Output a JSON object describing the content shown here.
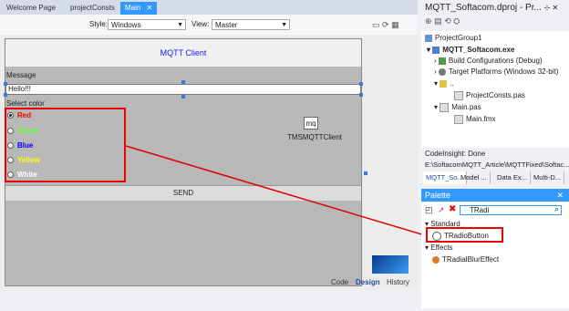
{
  "tabs": [
    {
      "label": "Welcome Page"
    },
    {
      "label": "projectConsts"
    },
    {
      "label": "Main"
    }
  ],
  "toolbar": {
    "style_label": "Style:",
    "style_value": "Windows",
    "view_label": "View:",
    "view_value": "Master"
  },
  "form": {
    "title": "MQTT Client",
    "message_label": "Message",
    "message_value": "Hello!!!",
    "select_color_label": "Select color",
    "radios": [
      {
        "label": "Red",
        "color": "#ff0000",
        "checked": true
      },
      {
        "label": "Green",
        "color": "#66ff33"
      },
      {
        "label": "Blue",
        "color": "#0000ff"
      },
      {
        "label": "Yellow",
        "color": "#ffff00"
      },
      {
        "label": "White",
        "color": "#ffffff"
      }
    ],
    "component_icon_text": "mq",
    "component_label": "TMSMQTTClient",
    "send_label": "SEND"
  },
  "bottom_tabs": [
    {
      "label": "Code"
    },
    {
      "label": "Design",
      "active": true
    },
    {
      "label": "History"
    }
  ],
  "project": {
    "title": "MQTT_Softacom.dproj - Pr...",
    "tree": [
      {
        "label": "ProjectGroup1"
      },
      {
        "label": "MQTT_Softacom.exe"
      },
      {
        "label": "Build Configurations (Debug)"
      },
      {
        "label": "Target Platforms (Windows 32-bit)"
      },
      {
        "label": ".."
      },
      {
        "label": "ProjectConsts.pas"
      },
      {
        "label": "Main.pas"
      },
      {
        "label": "Main.fmx"
      }
    ],
    "codeinsight": "CodeInsight: Done",
    "path": "E:\\SoftacomMQTT_Article\\MQTTFixed\\Softac...",
    "tabs": [
      {
        "label": "MQTT_So..."
      },
      {
        "label": "Model ..."
      },
      {
        "label": "Data Ex..."
      },
      {
        "label": "Multi-D..."
      }
    ]
  },
  "palette": {
    "title": "Palette",
    "search": "TRadi",
    "groups": [
      {
        "label": "Standard",
        "items": [
          {
            "label": "TRadioButton"
          }
        ]
      },
      {
        "label": "Effects",
        "items": [
          {
            "label": "TRadialBlurEffect"
          }
        ]
      }
    ]
  },
  "colors": {
    "accent": "#3399ff",
    "highlight_box": "#e00000",
    "form_bg": "#b8b8b8"
  }
}
